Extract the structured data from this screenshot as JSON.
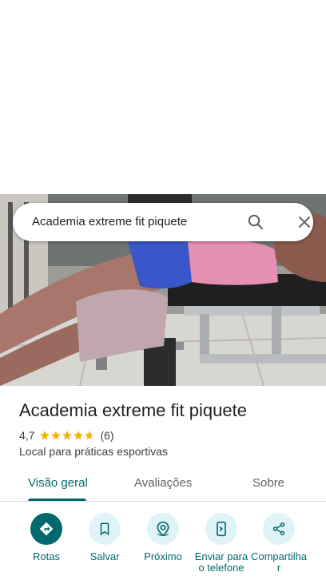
{
  "search": {
    "query": "Academia extreme fit piquete",
    "search_icon": "search-icon",
    "close_icon": "close-icon"
  },
  "place": {
    "title": "Academia extreme fit piquete",
    "rating": "4,7",
    "stars": 4.7,
    "review_count": "(6)",
    "category": "Local para práticas esportivas"
  },
  "tabs": [
    {
      "label": "Visão geral",
      "active": true
    },
    {
      "label": "Avaliações",
      "active": false
    },
    {
      "label": "Sobre",
      "active": false
    }
  ],
  "actions": [
    {
      "label": "Rotas",
      "icon": "directions-icon"
    },
    {
      "label": "Salvar",
      "icon": "bookmark-icon"
    },
    {
      "label": "Próximo",
      "icon": "nearby-icon"
    },
    {
      "label": "Enviar para o telefone",
      "icon": "send-to-phone-icon"
    },
    {
      "label": "Compartilhar",
      "icon": "share-icon"
    }
  ],
  "colors": {
    "accent": "#00696e",
    "action_bg": "#e0f4f8",
    "star": "#f4b400",
    "text": "#202124",
    "secondary_text": "#3c4043"
  }
}
